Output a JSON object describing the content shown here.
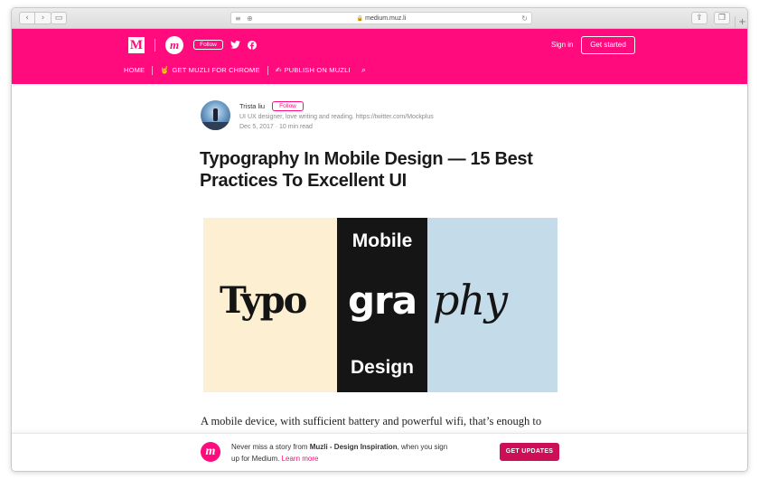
{
  "browser": {
    "url": "medium.muz.li",
    "back_icon": "‹",
    "forward_icon": "›",
    "sidebar_icon": "▭",
    "reader_icon": "≡",
    "add_icon": "⊕",
    "lock_icon": "🔒",
    "reload_icon": "↻",
    "share_icon": "⇪",
    "tabs_icon": "❐",
    "newtab_icon": "+"
  },
  "header": {
    "medium_logo": "M",
    "publication_logo": "m",
    "follow_label": "Follow",
    "signin_label": "Sign in",
    "get_started_label": "Get started",
    "nav": {
      "home": "HOME",
      "chrome_emoji": "🤘",
      "chrome": "GET MUZLI FOR CHROME",
      "publish_emoji": "✍",
      "publish": "PUBLISH ON MUZLI",
      "search_icon": "⌕"
    },
    "brand_color": "#ff0b7d"
  },
  "article": {
    "author": "Trista liu",
    "follow_label": "Follow",
    "bio": "UI UX designer, love writing and reading. https://twitter.com/Mockplus",
    "date": "Dec 5, 2017",
    "dot": " · ",
    "read_time": "10 min read",
    "title": "Typography In Mobile Design — 15 Best Practices To Excellent UI",
    "hero": {
      "mobile": "Mobile",
      "typo": "Typo",
      "gra": "gra",
      "phy": "phy",
      "design": "Design"
    },
    "body_first_line": "A mobile device, with sufficient battery and powerful wifi, that’s enough to"
  },
  "bottom_bar": {
    "logo": "m",
    "text_before": "Never miss a story from ",
    "publication": "Muzli - Design Inspiration",
    "text_after": ", when you sign",
    "text_line2": "up for Medium. ",
    "learn_more": "Learn more",
    "button": "GET UPDATES",
    "button_color": "#cc0f57"
  }
}
